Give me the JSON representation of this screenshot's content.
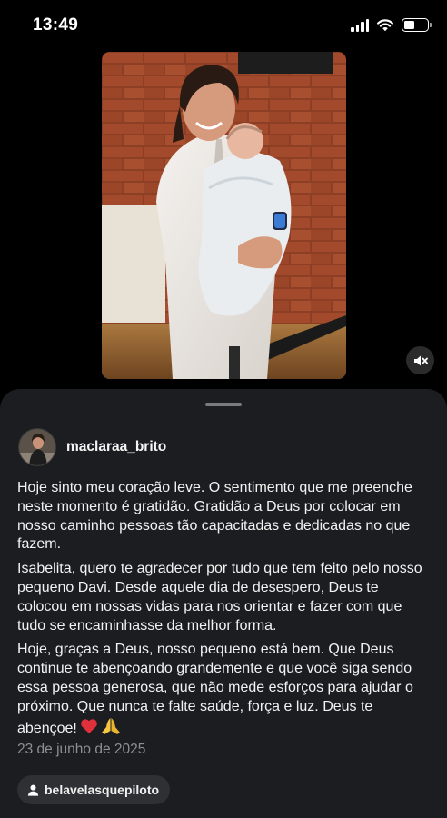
{
  "status_bar": {
    "time": "13:49",
    "icons": [
      "cellular-signal-icon",
      "wifi-icon",
      "battery-icon"
    ]
  },
  "story": {
    "media_alt": "Foto de uma profissional de jaleco branco segurando um bebê",
    "mute_icon": "muted-speaker-icon"
  },
  "post": {
    "username": "maclaraa_brito",
    "caption": [
      "Hoje sinto meu coração leve. O sentimento que me preenche neste momento é gratidão. Gratidão a Deus por colocar em nosso caminho pessoas tão capacitadas e dedicadas no que fazem.",
      "Isabelita, quero te agradecer por tudo que tem feito pelo nosso pequeno Davi. Desde aquele dia de desespero, Deus te colocou em nossas vidas para nos orientar e fazer com que tudo se encaminhasse da melhor forma.",
      "Hoje, graças a Deus, nosso pequeno está bem. Que Deus continue te abençoando grandemente e que você siga sendo essa pessoa generosa, que não mede esforços para ajudar o próximo. Que nunca te falte saúde, força e luz. Deus te abençoe!"
    ],
    "caption_emojis": [
      "red-heart-emoji",
      "folded-hands-emoji"
    ],
    "date": "23 de junho de 2025",
    "tagged_user": "belavelasquepiloto"
  },
  "colors": {
    "sheet_background": "#1c1d21",
    "secondary_text": "#8e8f94",
    "chip_background": "#2f3034",
    "heart": "#e0303c"
  }
}
